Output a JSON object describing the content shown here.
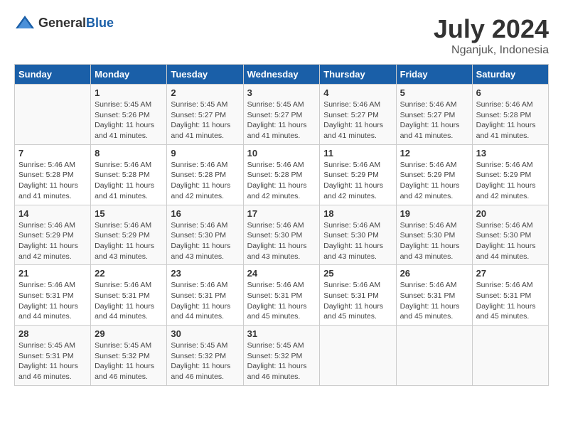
{
  "logo": {
    "text_general": "General",
    "text_blue": "Blue"
  },
  "title": {
    "month_year": "July 2024",
    "location": "Nganjuk, Indonesia"
  },
  "days_of_week": [
    "Sunday",
    "Monday",
    "Tuesday",
    "Wednesday",
    "Thursday",
    "Friday",
    "Saturday"
  ],
  "weeks": [
    [
      {
        "day": "",
        "info": ""
      },
      {
        "day": "1",
        "info": "Sunrise: 5:45 AM\nSunset: 5:26 PM\nDaylight: 11 hours\nand 41 minutes."
      },
      {
        "day": "2",
        "info": "Sunrise: 5:45 AM\nSunset: 5:27 PM\nDaylight: 11 hours\nand 41 minutes."
      },
      {
        "day": "3",
        "info": "Sunrise: 5:45 AM\nSunset: 5:27 PM\nDaylight: 11 hours\nand 41 minutes."
      },
      {
        "day": "4",
        "info": "Sunrise: 5:46 AM\nSunset: 5:27 PM\nDaylight: 11 hours\nand 41 minutes."
      },
      {
        "day": "5",
        "info": "Sunrise: 5:46 AM\nSunset: 5:27 PM\nDaylight: 11 hours\nand 41 minutes."
      },
      {
        "day": "6",
        "info": "Sunrise: 5:46 AM\nSunset: 5:28 PM\nDaylight: 11 hours\nand 41 minutes."
      }
    ],
    [
      {
        "day": "7",
        "info": "Sunrise: 5:46 AM\nSunset: 5:28 PM\nDaylight: 11 hours\nand 41 minutes."
      },
      {
        "day": "8",
        "info": "Sunrise: 5:46 AM\nSunset: 5:28 PM\nDaylight: 11 hours\nand 41 minutes."
      },
      {
        "day": "9",
        "info": "Sunrise: 5:46 AM\nSunset: 5:28 PM\nDaylight: 11 hours\nand 42 minutes."
      },
      {
        "day": "10",
        "info": "Sunrise: 5:46 AM\nSunset: 5:28 PM\nDaylight: 11 hours\nand 42 minutes."
      },
      {
        "day": "11",
        "info": "Sunrise: 5:46 AM\nSunset: 5:29 PM\nDaylight: 11 hours\nand 42 minutes."
      },
      {
        "day": "12",
        "info": "Sunrise: 5:46 AM\nSunset: 5:29 PM\nDaylight: 11 hours\nand 42 minutes."
      },
      {
        "day": "13",
        "info": "Sunrise: 5:46 AM\nSunset: 5:29 PM\nDaylight: 11 hours\nand 42 minutes."
      }
    ],
    [
      {
        "day": "14",
        "info": "Sunrise: 5:46 AM\nSunset: 5:29 PM\nDaylight: 11 hours\nand 42 minutes."
      },
      {
        "day": "15",
        "info": "Sunrise: 5:46 AM\nSunset: 5:29 PM\nDaylight: 11 hours\nand 43 minutes."
      },
      {
        "day": "16",
        "info": "Sunrise: 5:46 AM\nSunset: 5:30 PM\nDaylight: 11 hours\nand 43 minutes."
      },
      {
        "day": "17",
        "info": "Sunrise: 5:46 AM\nSunset: 5:30 PM\nDaylight: 11 hours\nand 43 minutes."
      },
      {
        "day": "18",
        "info": "Sunrise: 5:46 AM\nSunset: 5:30 PM\nDaylight: 11 hours\nand 43 minutes."
      },
      {
        "day": "19",
        "info": "Sunrise: 5:46 AM\nSunset: 5:30 PM\nDaylight: 11 hours\nand 43 minutes."
      },
      {
        "day": "20",
        "info": "Sunrise: 5:46 AM\nSunset: 5:30 PM\nDaylight: 11 hours\nand 44 minutes."
      }
    ],
    [
      {
        "day": "21",
        "info": "Sunrise: 5:46 AM\nSunset: 5:31 PM\nDaylight: 11 hours\nand 44 minutes."
      },
      {
        "day": "22",
        "info": "Sunrise: 5:46 AM\nSunset: 5:31 PM\nDaylight: 11 hours\nand 44 minutes."
      },
      {
        "day": "23",
        "info": "Sunrise: 5:46 AM\nSunset: 5:31 PM\nDaylight: 11 hours\nand 44 minutes."
      },
      {
        "day": "24",
        "info": "Sunrise: 5:46 AM\nSunset: 5:31 PM\nDaylight: 11 hours\nand 45 minutes."
      },
      {
        "day": "25",
        "info": "Sunrise: 5:46 AM\nSunset: 5:31 PM\nDaylight: 11 hours\nand 45 minutes."
      },
      {
        "day": "26",
        "info": "Sunrise: 5:46 AM\nSunset: 5:31 PM\nDaylight: 11 hours\nand 45 minutes."
      },
      {
        "day": "27",
        "info": "Sunrise: 5:46 AM\nSunset: 5:31 PM\nDaylight: 11 hours\nand 45 minutes."
      }
    ],
    [
      {
        "day": "28",
        "info": "Sunrise: 5:45 AM\nSunset: 5:31 PM\nDaylight: 11 hours\nand 46 minutes."
      },
      {
        "day": "29",
        "info": "Sunrise: 5:45 AM\nSunset: 5:32 PM\nDaylight: 11 hours\nand 46 minutes."
      },
      {
        "day": "30",
        "info": "Sunrise: 5:45 AM\nSunset: 5:32 PM\nDaylight: 11 hours\nand 46 minutes."
      },
      {
        "day": "31",
        "info": "Sunrise: 5:45 AM\nSunset: 5:32 PM\nDaylight: 11 hours\nand 46 minutes."
      },
      {
        "day": "",
        "info": ""
      },
      {
        "day": "",
        "info": ""
      },
      {
        "day": "",
        "info": ""
      }
    ]
  ]
}
